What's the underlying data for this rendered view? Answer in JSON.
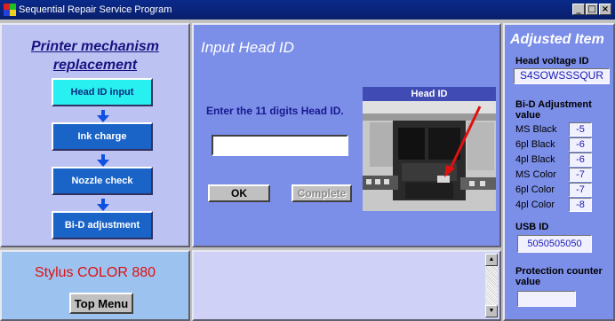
{
  "window": {
    "title": "Sequential Repair Service Program",
    "controls": [
      "minimize",
      "maximize",
      "close"
    ]
  },
  "left_panel": {
    "title_line1": "Printer mechanism",
    "title_line2": "replacement",
    "steps": [
      {
        "label": "Head ID input",
        "state": "active"
      },
      {
        "label": "Ink charge",
        "state": "done"
      },
      {
        "label": "Nozzle check",
        "state": "done"
      },
      {
        "label": "Bi-D adjustment",
        "state": "done"
      }
    ]
  },
  "model_panel": {
    "model_name": "Stylus COLOR 880",
    "top_menu_label": "Top Menu"
  },
  "main": {
    "title": "Input Head ID",
    "prompt": "Enter the 11 digits Head ID.",
    "head_id_value": "",
    "ok_label": "OK",
    "complete_label": "Complete",
    "photo_label": "Head ID"
  },
  "log": {
    "text": ""
  },
  "adjusted": {
    "title": "Adjusted Item",
    "head_voltage_label": "Head voltage ID",
    "head_voltage_value": "S4SOWSSSQUR",
    "bid_label_line1": "Bi-D Adjustment",
    "bid_label_line2": "value",
    "bid_values": [
      {
        "name": "MS Black",
        "value": "-5"
      },
      {
        "name": "6pl Black",
        "value": "-6"
      },
      {
        "name": "4pl Black",
        "value": "-6"
      },
      {
        "name": "MS Color",
        "value": "-7"
      },
      {
        "name": "6pl Color",
        "value": "-7"
      },
      {
        "name": "4pl Color",
        "value": "-8"
      }
    ],
    "usb_label": "USB ID",
    "usb_value": "5050505050",
    "protection_label_line1": "Protection counter",
    "protection_label_line2": "value",
    "protection_value": ""
  },
  "colors": {
    "titlebar": "#0a2a8a",
    "panel_blue": "#7b8ee8",
    "panel_lightblue": "#9cc3f0",
    "step_active": "#28f0f0",
    "step_done": "#1a64c8",
    "model_text": "#e01010"
  }
}
